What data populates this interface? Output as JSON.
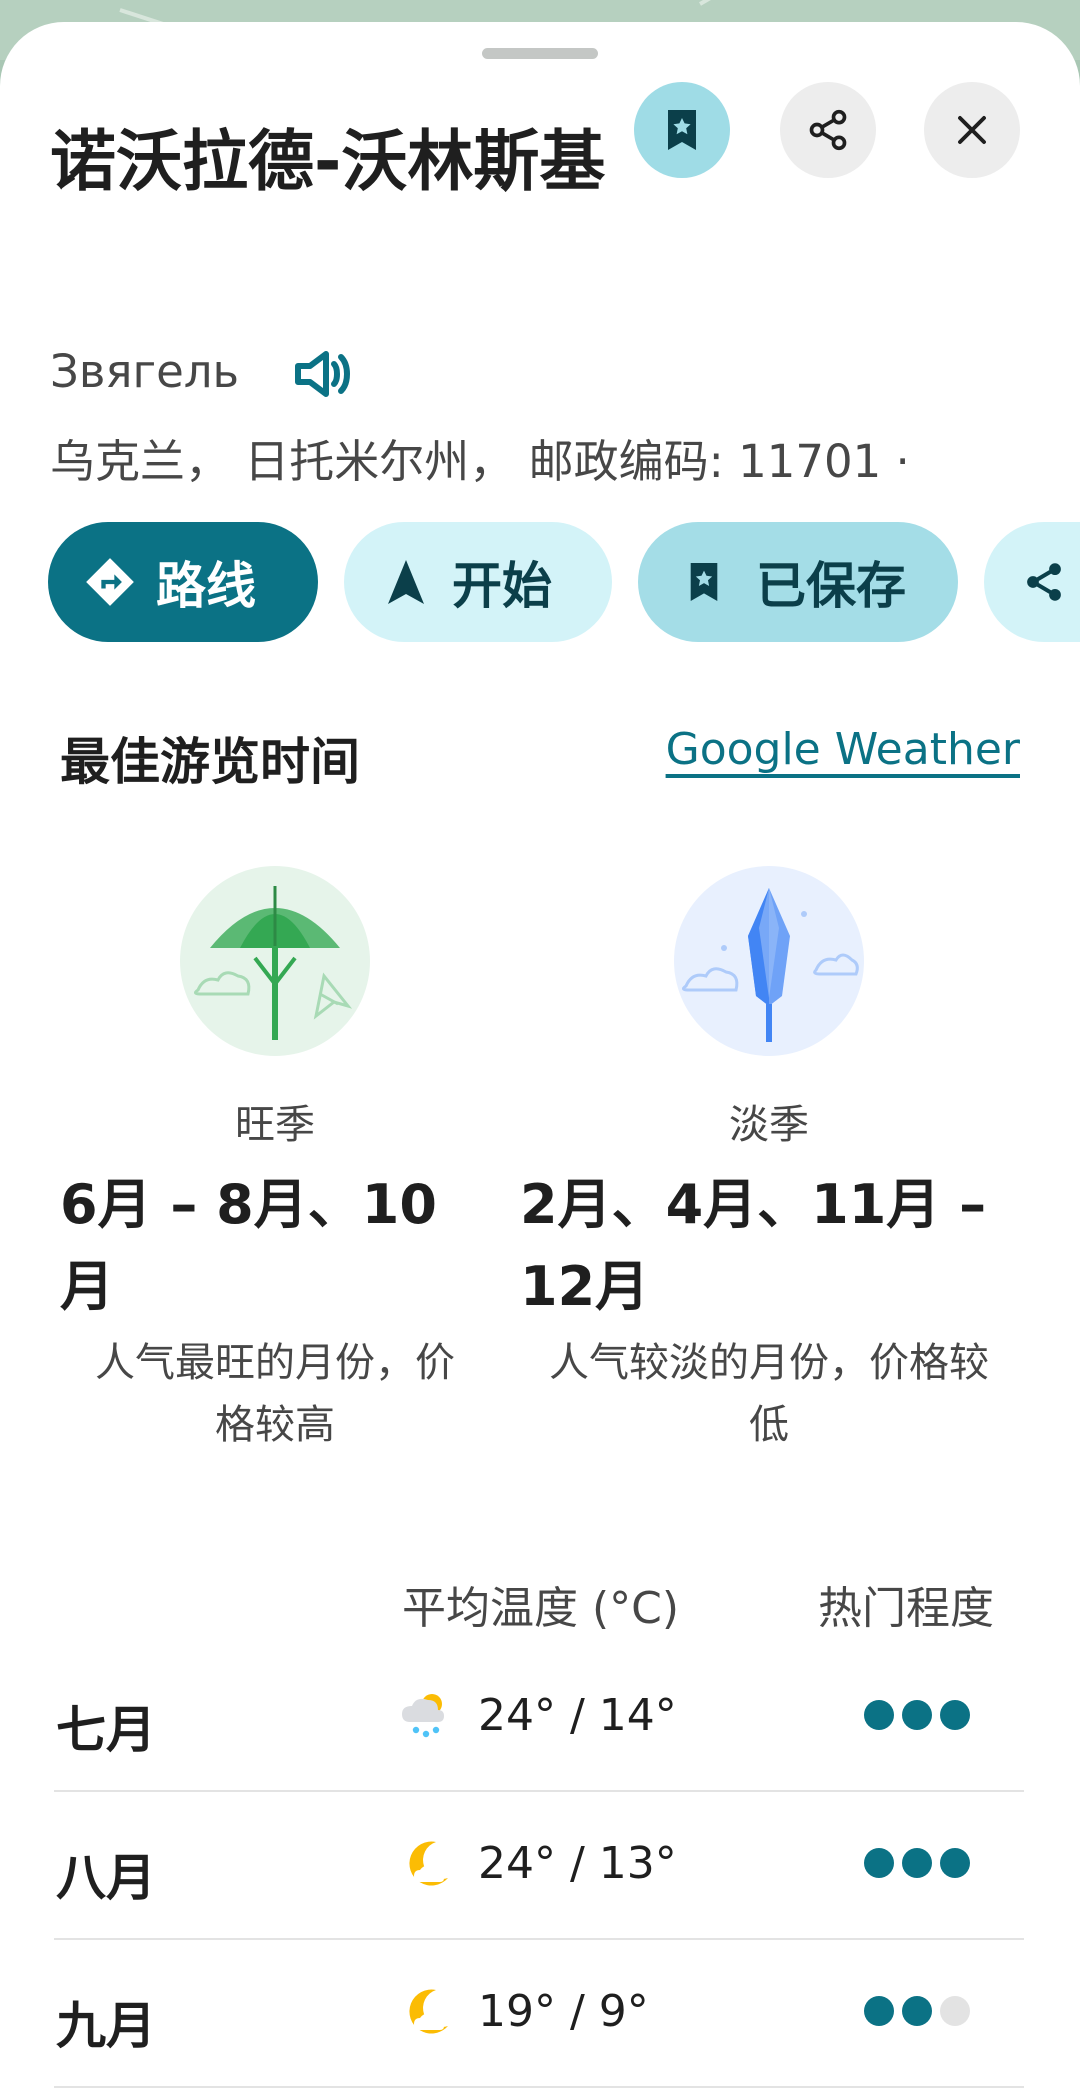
{
  "place": {
    "name": "诺沃拉德-沃林斯基",
    "transliteration": "Звягель",
    "address": "乌克兰， 日托米尔州， 邮政编码: 11701 · "
  },
  "header_actions": {
    "saved_icon": "bookmark-star-icon",
    "share_icon": "share-icon",
    "close_icon": "close-icon"
  },
  "chips": {
    "route": "路线",
    "start": "开始",
    "saved": "已保存",
    "share_label": ""
  },
  "best_time": {
    "title": "最佳游览时间",
    "source_link": "Google Weather",
    "peak": {
      "label": "旺季",
      "months_line1": "6月 – 8月、10",
      "months_line2": "月",
      "desc_line1": "人气最旺的月份，价",
      "desc_line2": "格较高"
    },
    "off": {
      "label": "淡季",
      "months_line1": "2月、4月、11月 –",
      "months_line2": "12月",
      "desc_line1": "人气较淡的月份，价格较",
      "desc_line2": "低"
    }
  },
  "table": {
    "col_temp": "平均温度 (°C)",
    "col_pop": "热门程度",
    "rows": [
      {
        "month": "七月",
        "weather_icon": "rain-cloud-icon",
        "temps": "24° / 14°",
        "popularity": 3
      },
      {
        "month": "八月",
        "weather_icon": "moon-cloud-icon",
        "temps": "24° / 13°",
        "popularity": 3
      },
      {
        "month": "九月",
        "weather_icon": "moon-cloud-icon",
        "temps": "19° / 9°",
        "popularity": 2
      }
    ]
  },
  "colors": {
    "accent": "#0b7285",
    "chip_light": "#d3f3f8",
    "peak_green": "#34a853",
    "off_blue": "#4285f4"
  }
}
